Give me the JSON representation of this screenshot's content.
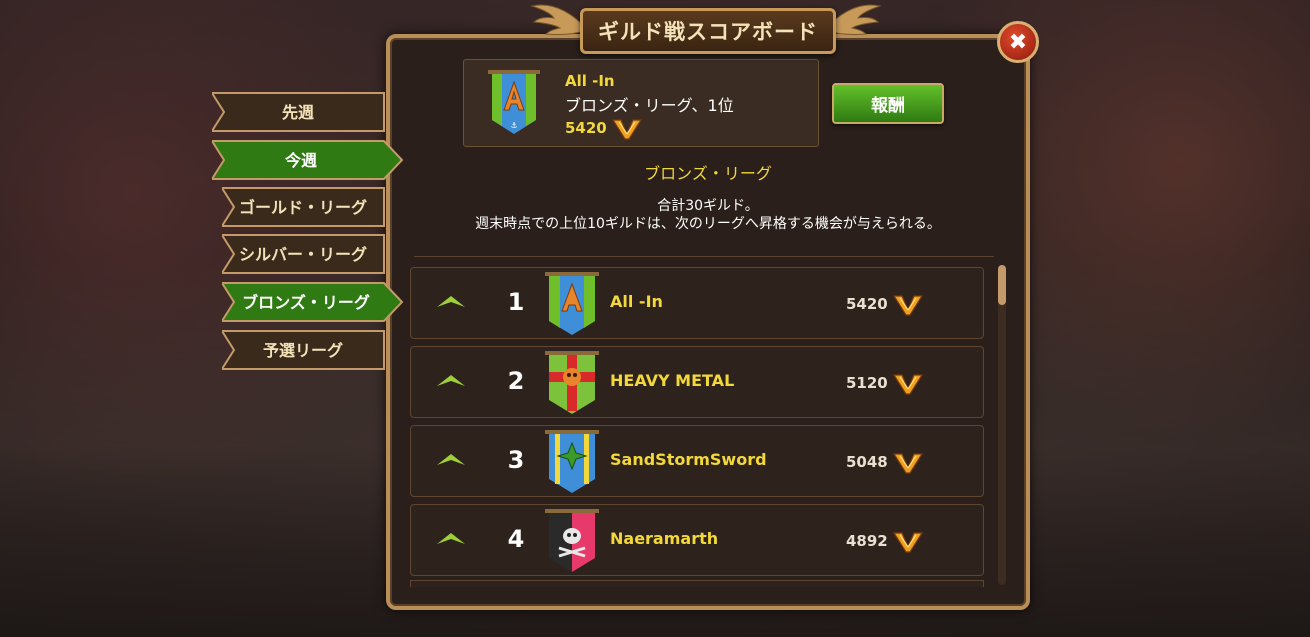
{
  "title": "ギルド戦スコアボード",
  "summary": {
    "guild_name": "All -In",
    "league_rank": "ブロンズ・リーグ、1位",
    "score": "5420",
    "emblem_letter": "A"
  },
  "reward_button": "報酬",
  "league_title": "ブロンズ・リーグ",
  "description": {
    "line1": "合計30ギルド。",
    "line2": "週末時点での上位10ギルドは、次のリーグへ昇格する機会が与えられる。"
  },
  "tabs": [
    {
      "label": "先週",
      "active": false
    },
    {
      "label": "今週",
      "active": true
    },
    {
      "label": "ゴールド・リーグ",
      "active": false
    },
    {
      "label": "シルバー・リーグ",
      "active": false
    },
    {
      "label": "ブロンズ・リーグ",
      "active": true
    },
    {
      "label": "予選リーグ",
      "active": false
    }
  ],
  "rows": [
    {
      "rank": "1",
      "name": "All -In",
      "score": "5420",
      "emblem": "letter-a"
    },
    {
      "rank": "2",
      "name": "HEAVY METAL",
      "score": "5120",
      "emblem": "skull-cross"
    },
    {
      "rank": "3",
      "name": "SandStormSword",
      "score": "5048",
      "emblem": "compass"
    },
    {
      "rank": "4",
      "name": "Naeramarth",
      "score": "4892",
      "emblem": "pirate-skull"
    }
  ],
  "colors": {
    "accent_gold": "#f2d83a",
    "active_tab_green": "#2f7a12",
    "panel_border": "#b98e58"
  },
  "icons": {
    "close": "close-icon",
    "score_badge": "v-wings-icon",
    "trend": "up-arrow-icon"
  }
}
